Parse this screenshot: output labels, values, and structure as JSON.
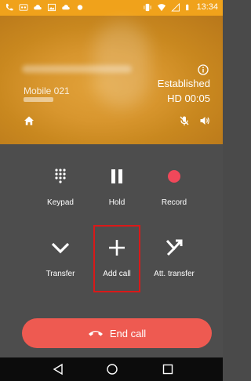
{
  "status_bar": {
    "time": "13:34",
    "left_icons": [
      "phone-icon",
      "voicemail-icon",
      "cloud-icon",
      "image-icon",
      "cloud-icon",
      "dot-icon"
    ],
    "right_icons": [
      "vibrate-icon",
      "wifi-icon",
      "signal-icon",
      "battery-icon"
    ]
  },
  "call": {
    "line_label": "Mobile 021",
    "status": "Established",
    "timer": "HD  00:05"
  },
  "controls": [
    {
      "label": "Keypad",
      "icon": "keypad-icon"
    },
    {
      "label": "Hold",
      "icon": "pause-icon"
    },
    {
      "label": "Record",
      "icon": "record-icon",
      "color": "#f0485a"
    },
    {
      "label": "Transfer",
      "icon": "transfer-icon"
    },
    {
      "label": "Add call",
      "icon": "plus-icon"
    },
    {
      "label": "Att. transfer",
      "icon": "attended-transfer-icon"
    }
  ],
  "end_call": {
    "label": "End call",
    "color": "#ee5a51"
  },
  "nav": [
    "back-icon",
    "home-circle-icon",
    "recents-icon"
  ],
  "colors": {
    "status_bar": "#f0a21b",
    "hero": "#d8962e",
    "panel": "#4d4d4d",
    "highlight": "#d91919"
  }
}
